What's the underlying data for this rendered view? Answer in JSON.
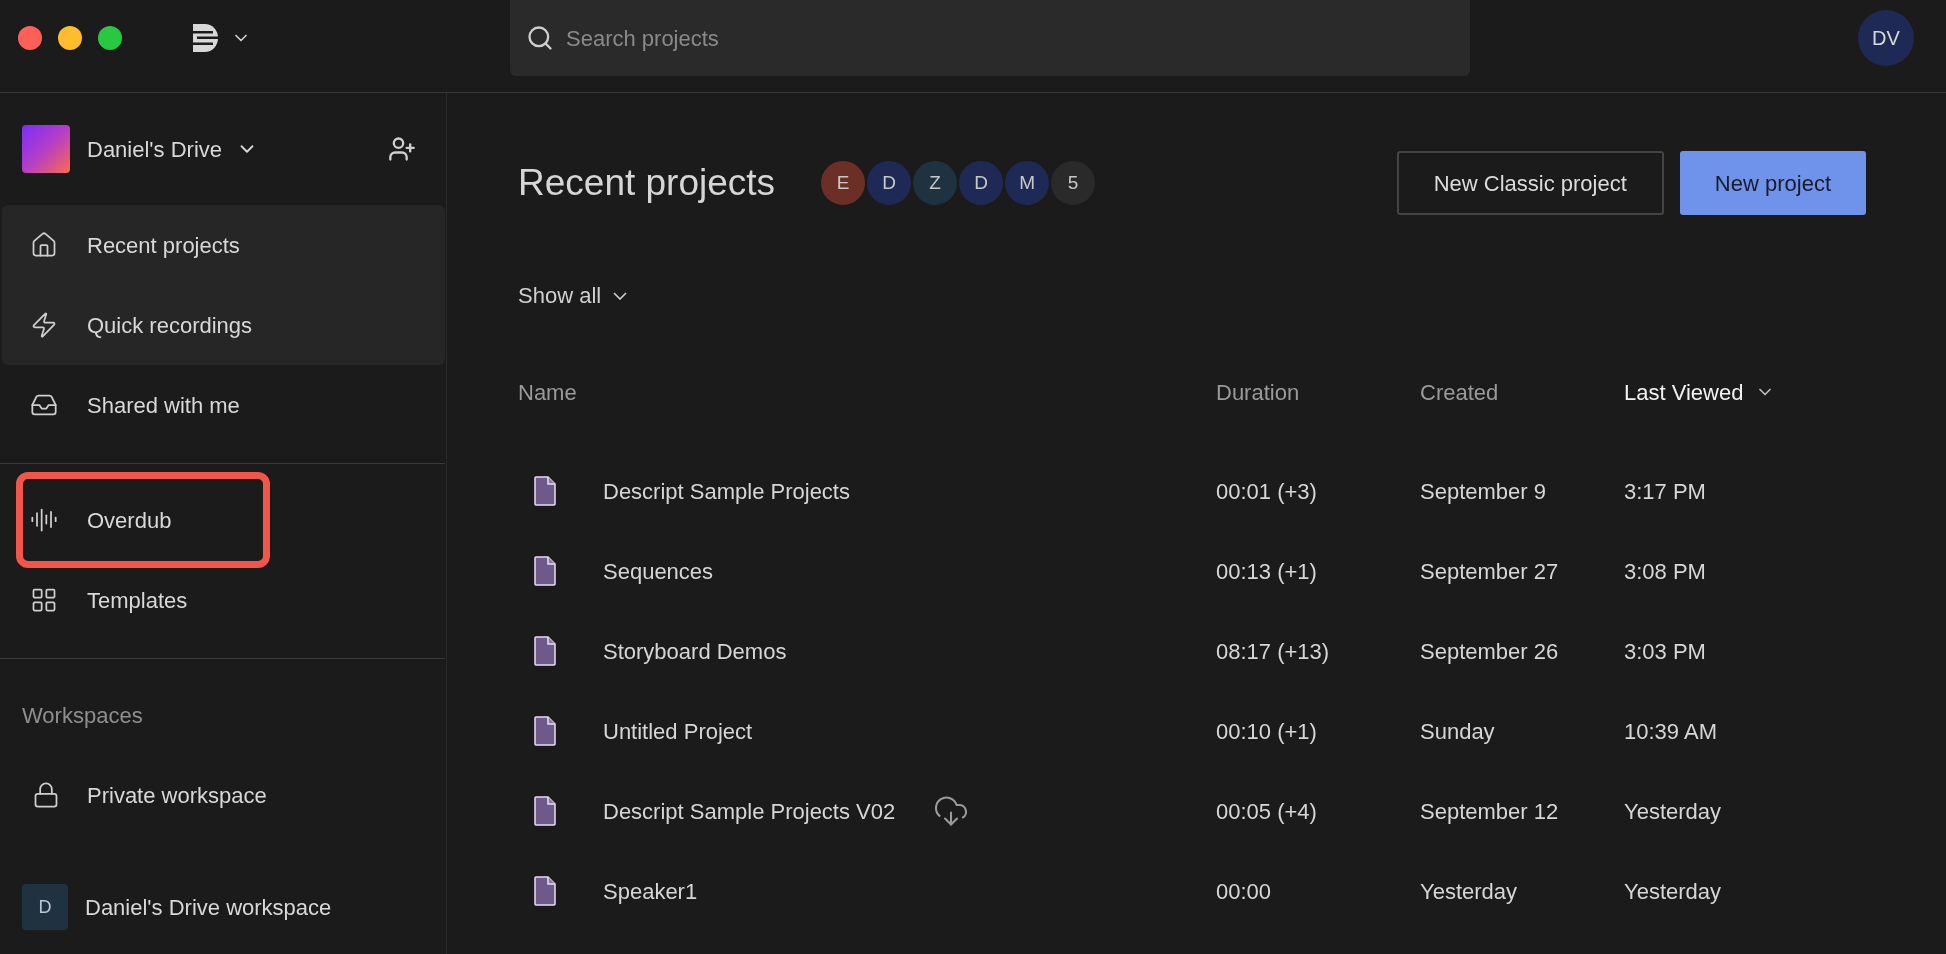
{
  "search": {
    "placeholder": "Search projects"
  },
  "user": {
    "initials": "DV"
  },
  "drive": {
    "name": "Daniel's Drive"
  },
  "nav_groups": [
    [
      {
        "label": "Recent projects",
        "highlighted": true,
        "annotated": false
      },
      {
        "label": "Quick recordings",
        "highlighted": true,
        "annotated": false
      },
      {
        "label": "Shared with me",
        "highlighted": false,
        "annotated": false
      }
    ],
    [
      {
        "label": "Overdub",
        "highlighted": false,
        "annotated": true
      },
      {
        "label": "Templates",
        "highlighted": false,
        "annotated": false
      }
    ]
  ],
  "workspaces": {
    "title": "Workspaces",
    "items": [
      {
        "kind": "lock",
        "label": "Private workspace"
      },
      {
        "kind": "initial",
        "label": "Daniel's Drive workspace",
        "initial": "D"
      }
    ]
  },
  "page": {
    "title": "Recent projects",
    "members": [
      {
        "initial": "E",
        "color": "#6b2f25"
      },
      {
        "initial": "D",
        "color": "#1e2a55"
      },
      {
        "initial": "Z",
        "color": "#1f3240"
      },
      {
        "initial": "D",
        "color": "#1e2a55"
      },
      {
        "initial": "M",
        "color": "#1e2a55"
      },
      {
        "initial": "5",
        "color": "#2a2a2a"
      }
    ],
    "buttons": [
      {
        "label": "New Classic project",
        "primary": false
      },
      {
        "label": "New project",
        "primary": true
      }
    ],
    "filter": "Show all"
  },
  "table": {
    "columns": [
      {
        "label": "Name",
        "sorted": false
      },
      {
        "label": "Duration",
        "sorted": false
      },
      {
        "label": "Created",
        "sorted": false
      },
      {
        "label": "Last Viewed",
        "sorted": true
      }
    ],
    "rows": [
      {
        "name": "Descript Sample Projects",
        "cloud": false,
        "duration": "00:01 (+3)",
        "created": "September 9",
        "viewed": "3:17 PM"
      },
      {
        "name": "Sequences",
        "cloud": false,
        "duration": "00:13 (+1)",
        "created": "September 27",
        "viewed": "3:08 PM"
      },
      {
        "name": "Storyboard Demos",
        "cloud": false,
        "duration": "08:17 (+13)",
        "created": "September 26",
        "viewed": "3:03 PM"
      },
      {
        "name": "Untitled Project",
        "cloud": false,
        "duration": "00:10 (+1)",
        "created": "Sunday",
        "viewed": "10:39 AM"
      },
      {
        "name": "Descript Sample Projects V02",
        "cloud": true,
        "duration": "00:05 (+4)",
        "created": "September 12",
        "viewed": "Yesterday"
      },
      {
        "name": "Speaker1",
        "cloud": false,
        "duration": "00:00",
        "created": "Yesterday",
        "viewed": "Yesterday"
      }
    ]
  }
}
